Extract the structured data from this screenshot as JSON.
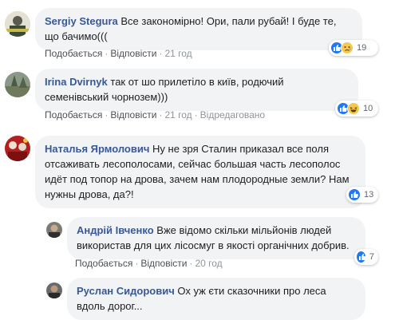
{
  "comments": [
    {
      "author": "Sergiy Stegura",
      "text": "Все закономірно! Ори, пали рубай! І буде те, що бачимо(((",
      "actions": {
        "like": "Подобається",
        "reply": "Відповісти",
        "time": "21 год"
      },
      "reactions": {
        "icons": [
          "like-icon",
          "sad-icon"
        ],
        "count": "19"
      }
    },
    {
      "author": "Irina Dvirnyk",
      "text": "так от шо прилетіло в київ, родючий семенівський чорнозем)))",
      "actions": {
        "like": "Подобається",
        "reply": "Відповісти",
        "time": "21 год",
        "edited": "Відредаговано"
      },
      "reactions": {
        "icons": [
          "like-icon",
          "haha-icon"
        ],
        "count": "10"
      }
    },
    {
      "author": "Наталья Ярмолович",
      "text": "Ну не зря Сталин приказал все поля отсаживать лесополосами, сейчас большая часть лесополос идёт под топор на дрова, зачем нам плодородные земли? Нам нужны дрова, да?!",
      "reactions": {
        "icons": [
          "like-icon"
        ],
        "count": "13"
      }
    },
    {
      "author": "Андрій Івченко",
      "text": "Вже відомо скільки мільйонів людей використав для цих лісосмуг в якості органічних добрив.",
      "actions": {
        "like": "Подобається",
        "reply": "Відповісти",
        "time": "20 год"
      },
      "reactions": {
        "icons": [
          "like-icon"
        ],
        "count": "7"
      }
    },
    {
      "author": "Руслан Сидорович",
      "text": "Ох уж єти сказочники про леса вдоль дорог..."
    }
  ],
  "colors": {
    "link": "#385898",
    "bubble": "#f2f3f5",
    "like": "#2078f4",
    "emoji": "#f7c84b"
  }
}
